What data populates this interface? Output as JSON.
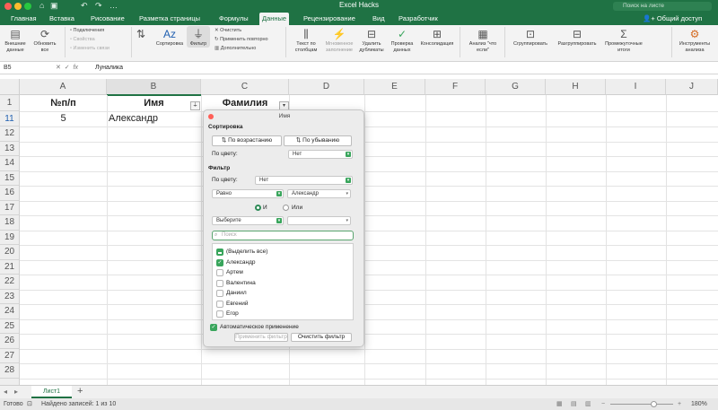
{
  "window": {
    "title": "Excel Hacks",
    "search_placeholder": "Поиск на листе",
    "share_label": "Общий доступ"
  },
  "tabs": [
    "Главная",
    "Вставка",
    "Рисование",
    "Разметка страницы",
    "Формулы",
    "Данные",
    "Рецензирование",
    "Вид",
    "Разработчик"
  ],
  "active_tab": "Данные",
  "ribbon": {
    "get_data": "Внешние данные",
    "refresh_all": "Обновить все",
    "connections": "Подключения",
    "properties": "Свойства",
    "edit_links": "Изменить связи",
    "sort": "Сортировка",
    "filter": "Фильтр",
    "clear": "Очистить",
    "reapply": "Применить повторно",
    "advanced": "Дополнительно",
    "text_to_columns": "Текст по столбцам",
    "flash_fill": "Мгновенное заполнение",
    "remove_duplicates": "Удалить дубликаты",
    "data_validation": "Проверка данных",
    "consolidate": "Консолидация",
    "what_if": "Анализ \"что если\"",
    "group": "Сгруппировать",
    "ungroup": "Разгруппировать",
    "subtotal": "Промежуточные итоги",
    "analysis_tools": "Инструменты анализа"
  },
  "formula_bar": {
    "name_box": "B5",
    "fx": "fx",
    "value": "Луналика"
  },
  "columns": [
    "A",
    "B",
    "C",
    "D",
    "E",
    "F",
    "G",
    "H",
    "I",
    "J"
  ],
  "rows": [
    "1",
    "11",
    "12",
    "13",
    "14",
    "15",
    "16",
    "17",
    "18",
    "19",
    "20",
    "21",
    "22",
    "23",
    "24",
    "25",
    "26",
    "27",
    "28"
  ],
  "headers": {
    "a": "№п/п",
    "b": "Имя",
    "c": "Фамилия"
  },
  "row11": {
    "a": "5",
    "b": "Александр"
  },
  "filter_popup": {
    "title": "Имя",
    "sort_section": "Сортировка",
    "sort_asc": "По возрастанию",
    "sort_desc": "По убыванию",
    "by_color_label": "По цвету:",
    "sort_color_value": "Нет",
    "filter_section": "Фильтр",
    "filter_color_label": "По цвету:",
    "filter_color_value": "Нет",
    "condition1": "Равно",
    "value1": "Александр",
    "and_label": "И",
    "or_label": "Или",
    "condition2": "Выберите",
    "value2": "",
    "search_placeholder": "Поиск",
    "items": [
      {
        "label": "(Выделить все)",
        "state": "mixed"
      },
      {
        "label": "Александр",
        "state": "checked"
      },
      {
        "label": "Артем",
        "state": "unchecked"
      },
      {
        "label": "Валентина",
        "state": "unchecked"
      },
      {
        "label": "Даниил",
        "state": "unchecked"
      },
      {
        "label": "Евгений",
        "state": "unchecked"
      },
      {
        "label": "Егор",
        "state": "unchecked"
      }
    ],
    "auto_apply": "Автоматическое применение",
    "apply_button": "Применить фильтр",
    "clear_button": "Очистить фильтр"
  },
  "sheet_tab": "Лист1",
  "status": {
    "ready": "Готово",
    "records": "Найдено записей: 1 из 10",
    "zoom": "180%"
  },
  "colors": {
    "excel_green": "#1f7244",
    "check_green": "#39a55c"
  }
}
